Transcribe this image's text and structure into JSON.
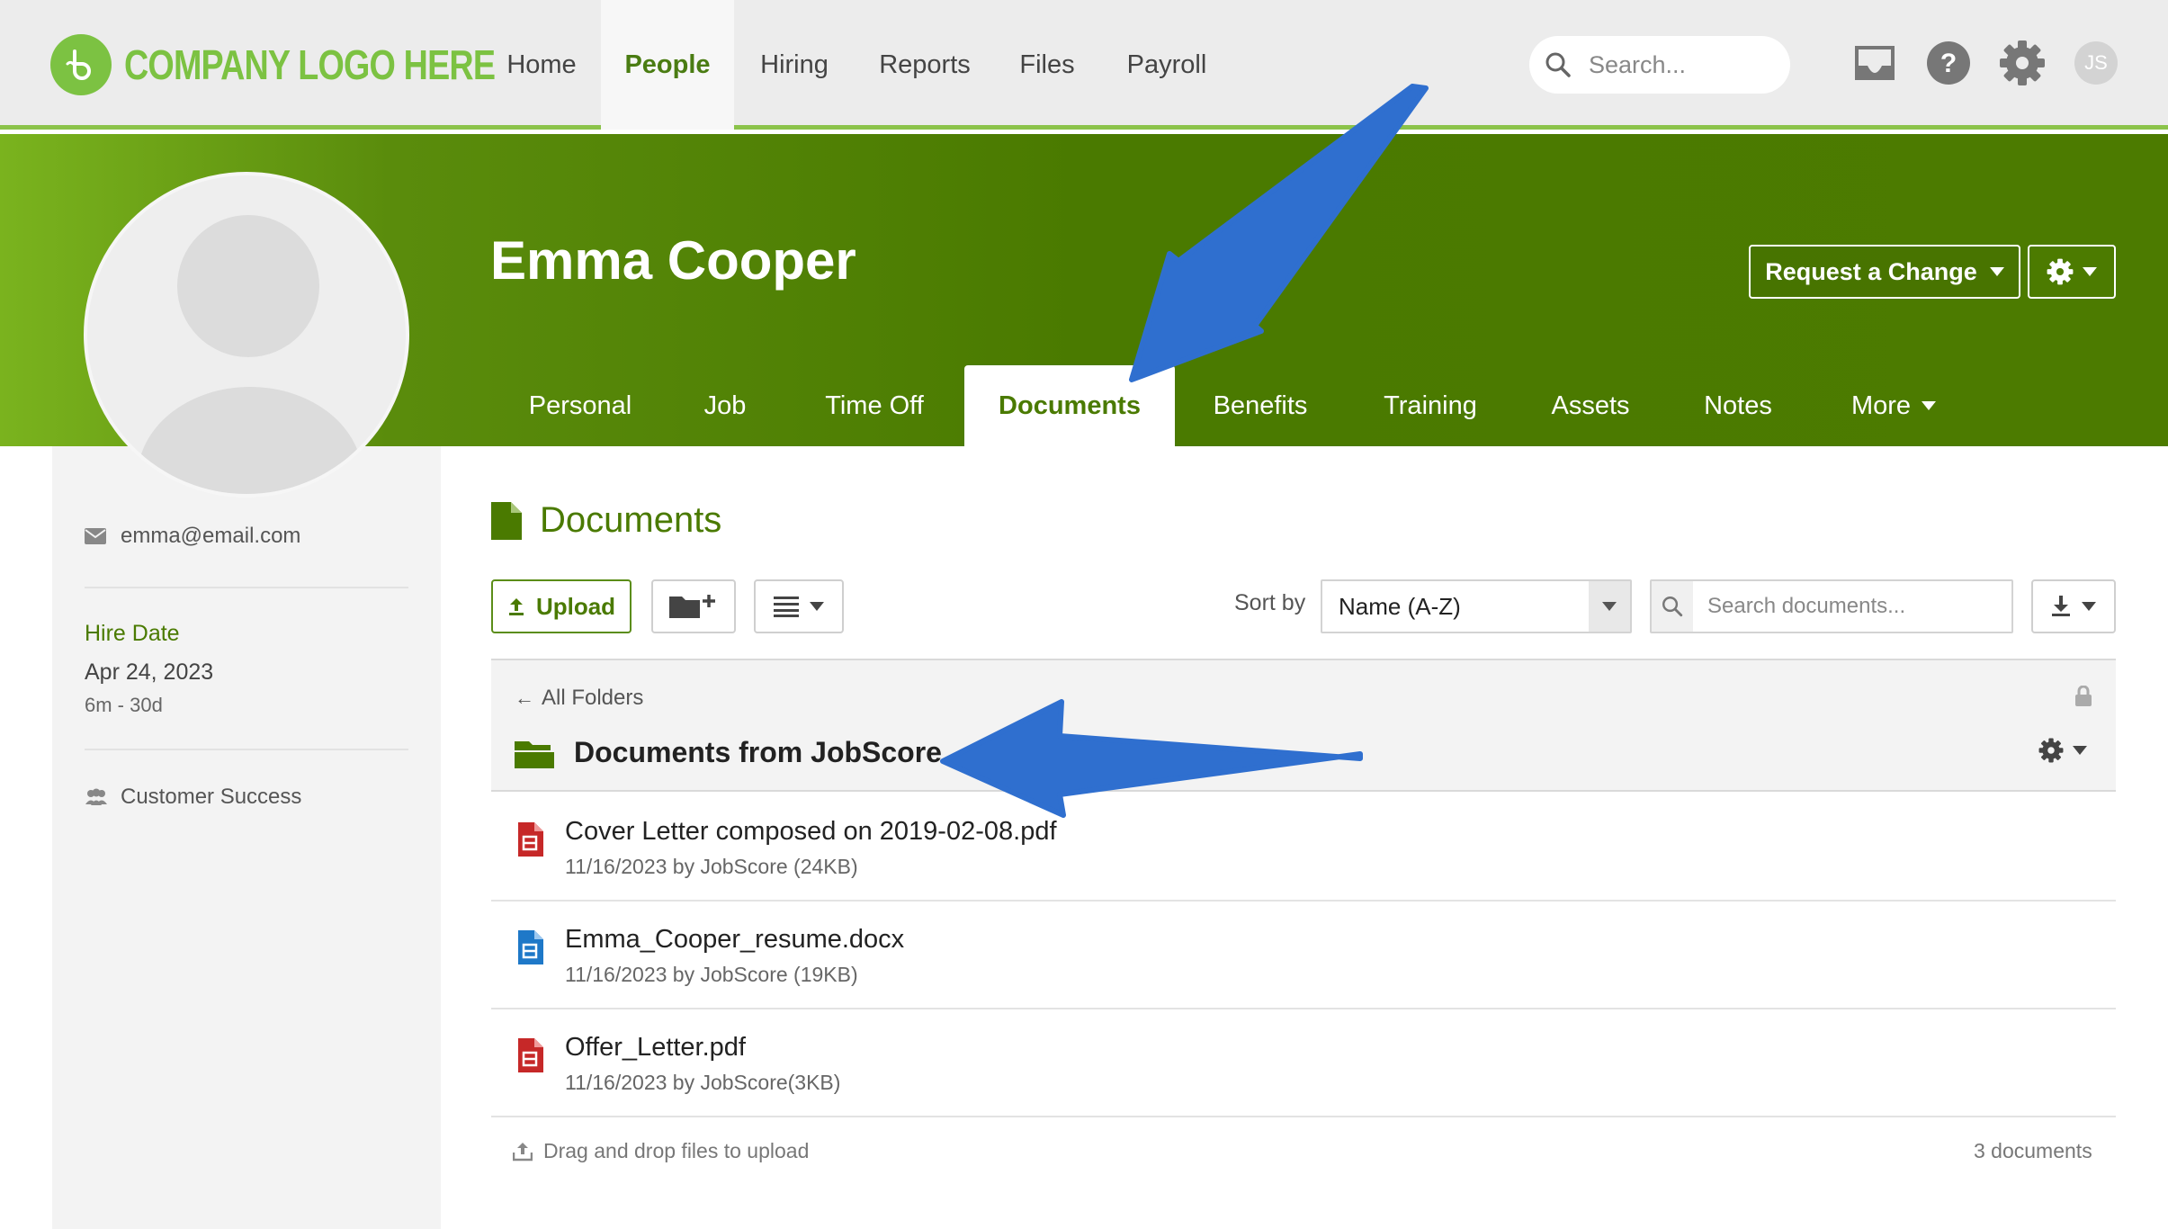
{
  "topnav": {
    "logo_text": "COMPANY LOGO HERE",
    "items": [
      {
        "label": "Home"
      },
      {
        "label": "People"
      },
      {
        "label": "Hiring"
      },
      {
        "label": "Reports"
      },
      {
        "label": "Files"
      },
      {
        "label": "Payroll"
      }
    ],
    "active_item": "People",
    "search_placeholder": "Search...",
    "icons": [
      "inbox-icon",
      "help-icon",
      "gear-icon",
      "user-avatar"
    ],
    "user_initials": "JS",
    "accent_color": "#7cc242"
  },
  "profile": {
    "name": "Emma Cooper",
    "request_change_label": "Request a Change",
    "banner_color": "#4c7b00",
    "tabs": [
      {
        "label": "Personal"
      },
      {
        "label": "Job"
      },
      {
        "label": "Time Off"
      },
      {
        "label": "Documents"
      },
      {
        "label": "Benefits"
      },
      {
        "label": "Training"
      },
      {
        "label": "Assets"
      },
      {
        "label": "Notes"
      },
      {
        "label": "More"
      }
    ],
    "active_tab": "Documents"
  },
  "sidebar": {
    "email": "emma@email.com",
    "hire_date_label": "Hire Date",
    "hire_date": "Apr 24, 2023",
    "tenure": "6m - 30d",
    "department": "Customer Success"
  },
  "documents": {
    "title": "Documents",
    "upload_label": "Upload",
    "sort_label": "Sort by",
    "sort_value": "Name (A-Z)",
    "search_placeholder": "Search documents...",
    "back_link": "All Folders",
    "folder_name": "Documents from JobScore",
    "files": [
      {
        "name": "Cover Letter composed on 2019-02-08.pdf",
        "meta": "11/16/2023 by JobScore (24KB)",
        "type": "pdf"
      },
      {
        "name": "Emma_Cooper_resume.docx",
        "meta": "11/16/2023 by JobScore (19KB)",
        "type": "docx"
      },
      {
        "name": "Offer_Letter.pdf",
        "meta": "11/16/2023 by JobScore(3KB)",
        "type": "pdf"
      }
    ],
    "drop_hint": "Drag and drop files to upload",
    "count_text": "3 documents"
  },
  "annotations": {
    "arrow_color": "#2f6fcf"
  }
}
